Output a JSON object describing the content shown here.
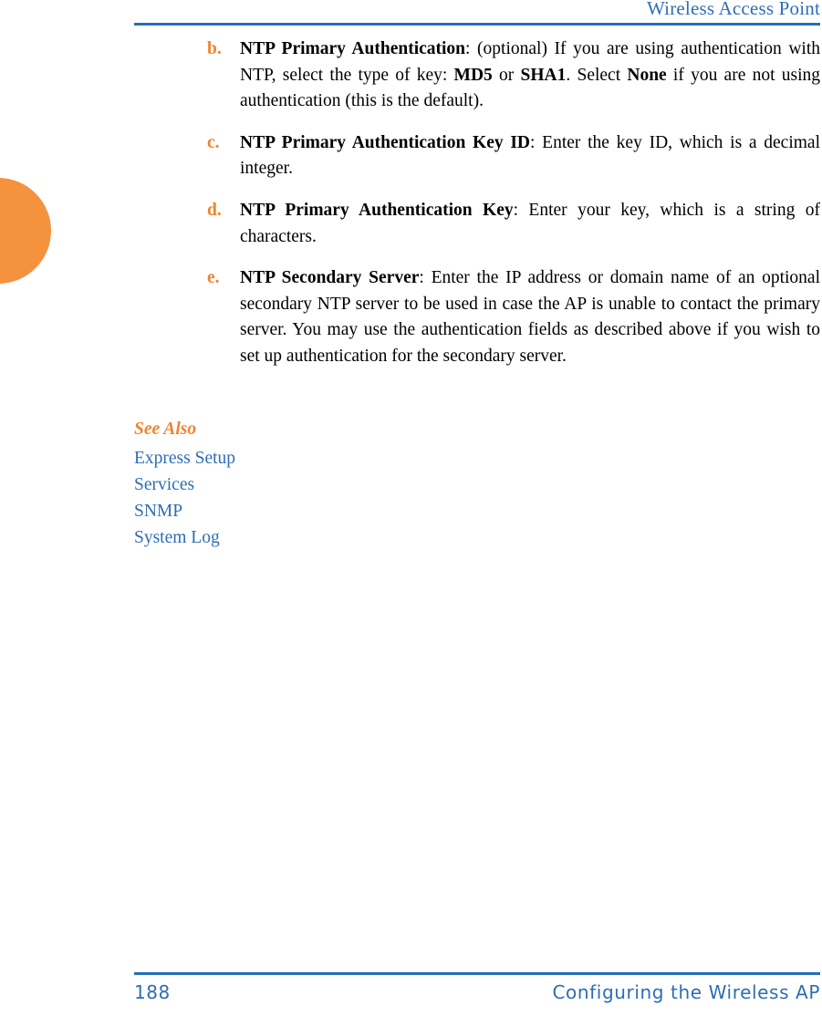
{
  "header": {
    "title": "Wireless Access Point"
  },
  "decor": {
    "edge_tab_color": "#F5923E"
  },
  "colors": {
    "accent_orange": "#F0842B",
    "link_blue": "#2E6DB4",
    "rule_blue": "#2170B5"
  },
  "list_items": [
    {
      "marker": "b.",
      "term": "NTP Primary Authentication",
      "text_1": ": (optional) If you are using authentication with NTP, select the type of key: ",
      "bold_1": "MD5",
      "text_2": " or ",
      "bold_2": "SHA1",
      "text_3": ". Select ",
      "bold_3": "None",
      "text_4": " if you are not using authentication (this is the default)."
    },
    {
      "marker": "c.",
      "term": "NTP Primary Authentication Key ID",
      "text_1": ": Enter the key ID, which is a decimal integer."
    },
    {
      "marker": "d.",
      "term": "NTP Primary Authentication Key",
      "text_1": ": Enter your key, which is a string of characters."
    },
    {
      "marker": "e.",
      "term": "NTP Secondary Server",
      "text_1": ": Enter the IP address or domain name of an optional secondary NTP server to be used in case the AP is unable to contact the primary server. You may use the authentication fields as described above if you wish to set up authentication for the secondary server."
    }
  ],
  "see_also": {
    "title": "See Also",
    "links": [
      {
        "label": "Express Setup"
      },
      {
        "label": "Services"
      },
      {
        "label": "SNMP"
      },
      {
        "label": "System Log"
      }
    ]
  },
  "footer": {
    "page_number": "188",
    "section_title": "Configuring the Wireless AP"
  }
}
